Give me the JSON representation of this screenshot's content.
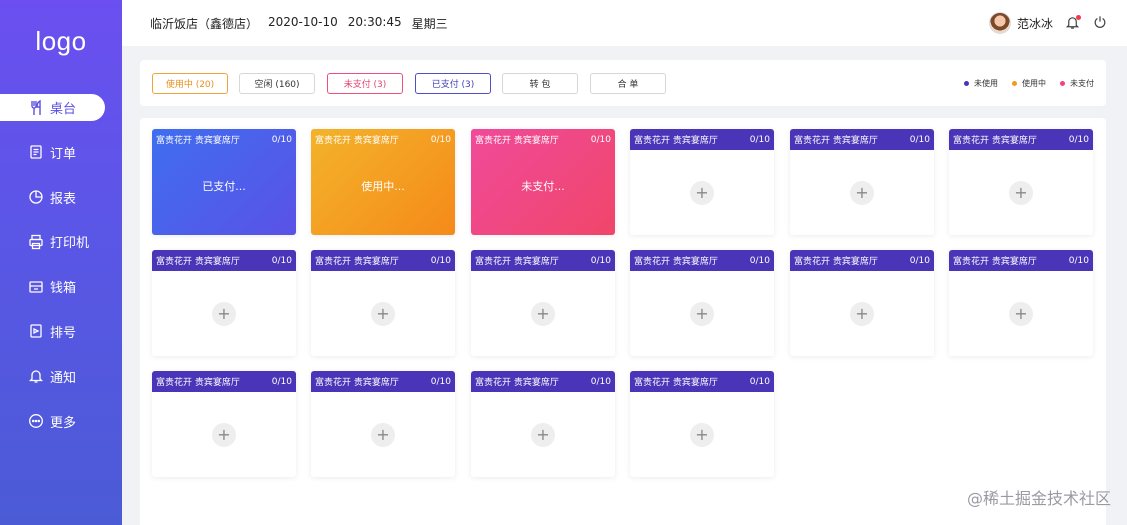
{
  "app": {
    "logo": "logo"
  },
  "sidebar": {
    "items": [
      {
        "label": "桌台",
        "icon": "utensils-icon",
        "active": true
      },
      {
        "label": "订单",
        "icon": "document-icon",
        "active": false
      },
      {
        "label": "报表",
        "icon": "pie-chart-icon",
        "active": false
      },
      {
        "label": "打印机",
        "icon": "printer-icon",
        "active": false
      },
      {
        "label": "钱箱",
        "icon": "cash-box-icon",
        "active": false
      },
      {
        "label": "排号",
        "icon": "queue-ticket-icon",
        "active": false
      },
      {
        "label": "通知",
        "icon": "bell-icon",
        "active": false
      },
      {
        "label": "更多",
        "icon": "more-icon",
        "active": false
      }
    ]
  },
  "header": {
    "store": "临沂饭店（鑫德店）",
    "date": "2020-10-10",
    "time": "20:30:45",
    "weekday": "星期三",
    "username": "范冰冰"
  },
  "filters": {
    "in_use": "使用中 (20)",
    "free": "空闲 (160)",
    "unpaid": "未支付 (3)",
    "paid": "已支付 (3)",
    "transfer": "转 包",
    "merge": "合 单"
  },
  "legend": {
    "unused": "未使用",
    "in_use": "使用中",
    "unpaid": "未支付"
  },
  "colors": {
    "accent": "#4a34b8",
    "in_use": "#f39a1e",
    "unpaid": "#f0457f",
    "paid": "#4f5ce8"
  },
  "tables": [
    {
      "name": "富贵花开 贵宾宴席厅",
      "count": "0/10",
      "status": "paid",
      "status_text": "已支付..."
    },
    {
      "name": "富贵花开 贵宾宴席厅",
      "count": "0/10",
      "status": "in_use",
      "status_text": "使用中..."
    },
    {
      "name": "富贵花开 贵宾宴席厅",
      "count": "0/10",
      "status": "unpaid",
      "status_text": "未支付..."
    },
    {
      "name": "富贵花开 贵宾宴席厅",
      "count": "0/10",
      "status": "free",
      "status_text": "+"
    },
    {
      "name": "富贵花开 贵宾宴席厅",
      "count": "0/10",
      "status": "free",
      "status_text": "+"
    },
    {
      "name": "富贵花开 贵宾宴席厅",
      "count": "0/10",
      "status": "free",
      "status_text": "+"
    },
    {
      "name": "富贵花开 贵宾宴席厅",
      "count": "0/10",
      "status": "free",
      "status_text": "+"
    },
    {
      "name": "富贵花开 贵宾宴席厅",
      "count": "0/10",
      "status": "free",
      "status_text": "+"
    },
    {
      "name": "富贵花开 贵宾宴席厅",
      "count": "0/10",
      "status": "free",
      "status_text": "+"
    },
    {
      "name": "富贵花开 贵宾宴席厅",
      "count": "0/10",
      "status": "free",
      "status_text": "+"
    },
    {
      "name": "富贵花开 贵宾宴席厅",
      "count": "0/10",
      "status": "free",
      "status_text": "+"
    },
    {
      "name": "富贵花开 贵宾宴席厅",
      "count": "0/10",
      "status": "free",
      "status_text": "+"
    },
    {
      "name": "富贵花开 贵宾宴席厅",
      "count": "0/10",
      "status": "free",
      "status_text": "+"
    },
    {
      "name": "富贵花开 贵宾宴席厅",
      "count": "0/10",
      "status": "free",
      "status_text": "+"
    },
    {
      "name": "富贵花开 贵宾宴席厅",
      "count": "0/10",
      "status": "free",
      "status_text": "+"
    },
    {
      "name": "富贵花开 贵宾宴席厅",
      "count": "0/10",
      "status": "free",
      "status_text": "+"
    }
  ],
  "watermark": "@稀土掘金技术社区"
}
